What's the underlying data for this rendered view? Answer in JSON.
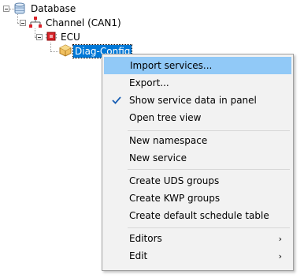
{
  "tree": {
    "root_label": "Database",
    "channel_label": "Channel (CAN1)",
    "ecu_label": "ECU",
    "selected_label": "Diag-Config"
  },
  "menu": {
    "items": [
      {
        "label": "Import services...",
        "highlighted": true
      },
      {
        "label": "Export..."
      },
      {
        "label": "Show service data in panel",
        "checked": true
      },
      {
        "label": "Open tree view"
      },
      {
        "label": "New namespace"
      },
      {
        "label": "New service"
      },
      {
        "label": "Create UDS groups"
      },
      {
        "label": "Create KWP groups"
      },
      {
        "label": "Create default schedule table"
      },
      {
        "label": "Editors",
        "submenu": true
      },
      {
        "label": "Edit",
        "submenu": true
      }
    ],
    "submenu_arrow": "›"
  },
  "colors": {
    "selection": "#0078d7",
    "menu_highlight": "#91c9f7",
    "menu_bg": "#f2f2f2"
  },
  "icons": [
    "database-icon",
    "network-icon",
    "ecu-chip-icon",
    "package-icon",
    "checkmark-icon",
    "chevron-right-icon"
  ]
}
